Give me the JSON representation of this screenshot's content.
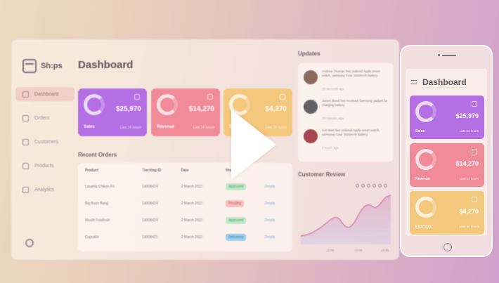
{
  "dashboard": {
    "brand": "Sh:ps",
    "title": "Dashboard",
    "nav": [
      "Dashboard",
      "Orders",
      "Customers",
      "Products",
      "Analytics"
    ],
    "stats": [
      {
        "label": "Sales",
        "value": "$25,970",
        "sub": "Last 24 hours",
        "color": "#a95ce0"
      },
      {
        "label": "Revenue",
        "value": "$14,270",
        "sub": "Last 24 hours",
        "color": "#ef7c8c"
      },
      {
        "label": "Expenses",
        "value": "$4,270",
        "sub": "Last 24 hours",
        "color": "#f2c16a"
      }
    ],
    "recent_orders_title": "Recent Orders",
    "table": {
      "headers": [
        "Product",
        "Tracking ID",
        "Date",
        "Status",
        ""
      ],
      "rows": [
        {
          "product": "Lasania Chiken Fri",
          "id": "18908424",
          "date": "2 March 2022",
          "status": "Approved",
          "action": "Details"
        },
        {
          "product": "Big Baza Bang",
          "id": "18908424",
          "date": "2 March 2022",
          "status": "Pending",
          "action": "Details"
        },
        {
          "product": "Mouth Freshner",
          "id": "18908424",
          "date": "2 March 2022",
          "status": "Approved",
          "action": "Details"
        },
        {
          "product": "Cupcake",
          "id": "18908421",
          "date": "2 March 2022",
          "status": "Delivered",
          "action": "Details"
        }
      ]
    }
  },
  "updates": {
    "title": "Updates",
    "items": [
      {
        "text": "Andrew Thomas has ordered Apple smart watch, samsung Gear 2500mAh battery.",
        "time": "25 seconds ago"
      },
      {
        "text": "James Bond has received Samsung gadget for charging battery.",
        "time": "30 minutes ago"
      },
      {
        "text": "Iron Man has ordered Apple smart watch, samsung Gear 2500mAh battery.",
        "time": "2 hours ago"
      }
    ]
  },
  "review": {
    "title": "Customer Review",
    "axis": [
      "12:00",
      "14:00",
      "16:00"
    ]
  },
  "phone": {
    "title": "Dashboard",
    "stats": [
      {
        "label": "Sales",
        "value": "$25,970",
        "sub": "Last 24 hours"
      },
      {
        "label": "Revenue",
        "value": "$14,270",
        "sub": "Last 24 hours"
      },
      {
        "label": "Expenses",
        "value": "$4,270",
        "sub": "Last 24 hours"
      }
    ]
  },
  "colors": {
    "purple": "#a95ce0",
    "coral": "#ef7c8c",
    "yellow": "#f2c16a",
    "chart_line": "#d98ab0"
  }
}
